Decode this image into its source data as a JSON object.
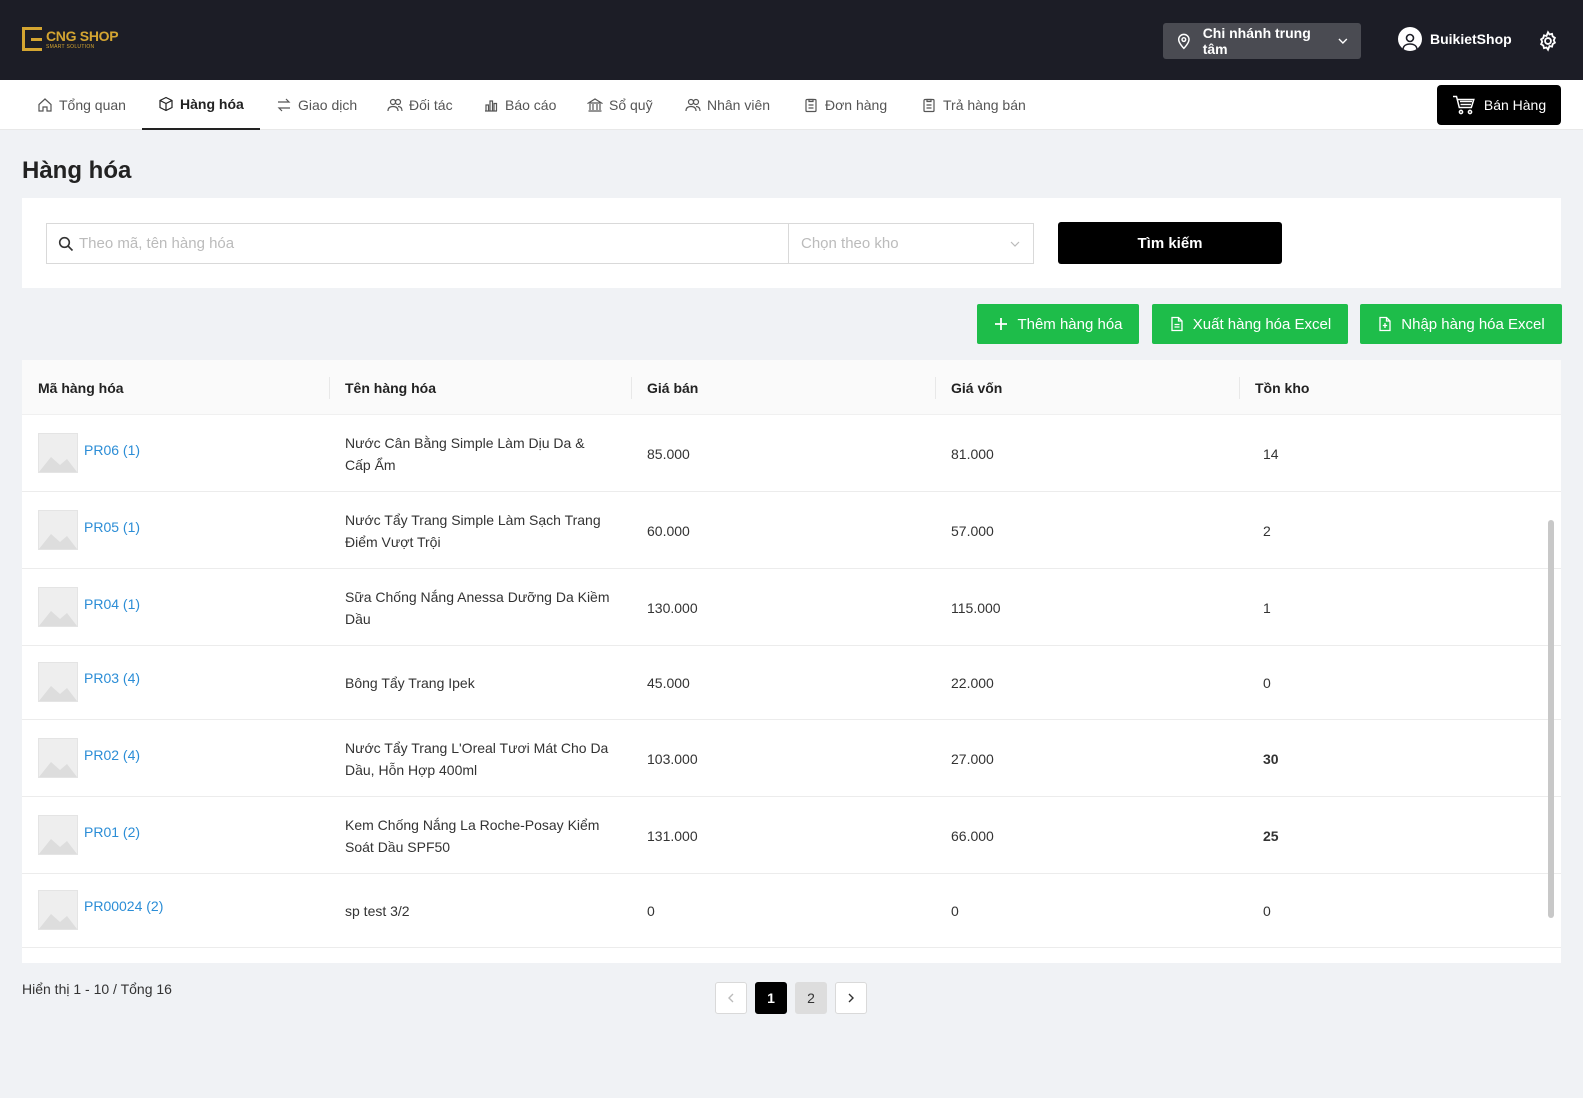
{
  "brand": {
    "name": "CNG SHOP",
    "tagline": "SMART SOLUTION",
    "accent": "#d4a531"
  },
  "header": {
    "branch": "Chi nhánh trung tâm",
    "user": "BuikietShop"
  },
  "nav": {
    "items": [
      {
        "label": "Tổng quan",
        "icon": "home-icon"
      },
      {
        "label": "Hàng hóa",
        "icon": "box-icon"
      },
      {
        "label": "Giao dịch",
        "icon": "swap-icon"
      },
      {
        "label": "Đối tác",
        "icon": "partners-icon"
      },
      {
        "label": "Báo cáo",
        "icon": "chart-icon"
      },
      {
        "label": "Sổ quỹ",
        "icon": "bank-icon"
      },
      {
        "label": "Nhân viên",
        "icon": "staff-icon"
      },
      {
        "label": "Đơn hàng",
        "icon": "clipboard-icon"
      },
      {
        "label": "Trả hàng bán",
        "icon": "clipboard-icon"
      }
    ],
    "active": "Hàng hóa",
    "sell_label": "Bán Hàng"
  },
  "page": {
    "title": "Hàng hóa"
  },
  "search": {
    "placeholder": "Theo mã, tên hàng hóa",
    "warehouse_placeholder": "Chọn theo kho",
    "button": "Tìm kiếm"
  },
  "actions": {
    "add": "Thêm hàng hóa",
    "export": "Xuất hàng hóa Excel",
    "import": "Nhập hàng hóa Excel",
    "color": "#1ebd4a"
  },
  "table": {
    "columns": [
      "Mã hàng hóa",
      "Tên hàng hóa",
      "Giá bán",
      "Giá vốn",
      "Tồn kho"
    ],
    "rows": [
      {
        "code": "PR06 (1)",
        "name": "Nước Cân Bằng Simple Làm Dịu Da & Cấp Ẩm",
        "price": "85.000",
        "cost": "81.000",
        "stock": "14"
      },
      {
        "code": "PR05 (1)",
        "name": "Nước Tẩy Trang Simple Làm Sạch Trang Điểm Vượt Trội",
        "price": "60.000",
        "cost": "57.000",
        "stock": "2"
      },
      {
        "code": "PR04 (1)",
        "name": "Sữa Chống Nắng Anessa Dưỡng Da Kiềm Dầu",
        "price": "130.000",
        "cost": "115.000",
        "stock": "1"
      },
      {
        "code": "PR03 (4)",
        "name": "Bông Tẩy Trang Ipek",
        "price": "45.000",
        "cost": "22.000",
        "stock": "0"
      },
      {
        "code": "PR02 (4)",
        "name": "Nước Tẩy Trang L'Oreal Tươi Mát Cho Da Dầu, Hỗn Hợp 400ml",
        "price": "103.000",
        "cost": "27.000",
        "stock": "30"
      },
      {
        "code": "PR01 (2)",
        "name": "Kem Chống Nắng La Roche-Posay Kiểm Soát Dầu SPF50",
        "price": "131.000",
        "cost": "66.000",
        "stock": "25"
      },
      {
        "code": "PR00024 (2)",
        "name": "sp test 3/2",
        "price": "0",
        "cost": "0",
        "stock": "0"
      }
    ]
  },
  "pagination": {
    "summary": "Hiển thị 1 - 10 / Tổng 16",
    "pages": [
      "1",
      "2"
    ],
    "current": "1"
  }
}
